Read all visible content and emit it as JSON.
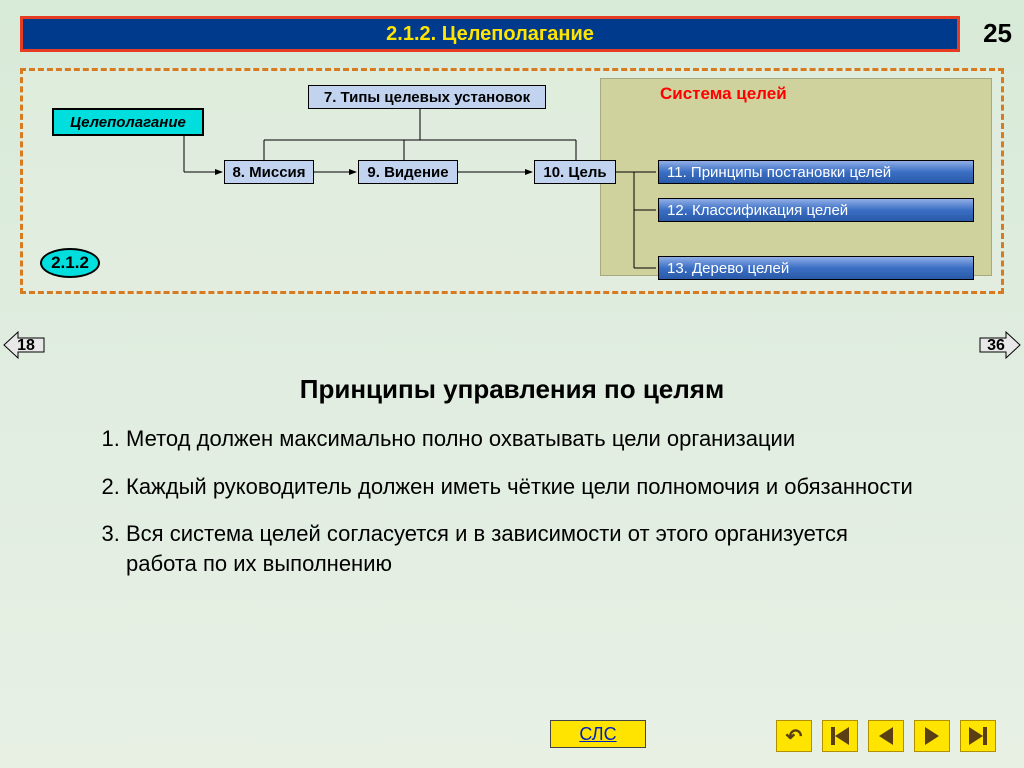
{
  "header": {
    "title": "2.1.2. Целеполагание",
    "slide_number": "25"
  },
  "diagram": {
    "main_label": "Целеполагание",
    "marker": "2.1.2",
    "system_label": "Система целей",
    "boxes": {
      "n7": "7. Типы целевых установок",
      "n8": "8. Миссия",
      "n9": "9. Видение",
      "n10": "10. Цель",
      "n11": "11. Принципы постановки целей",
      "n12": "12. Классификация целей",
      "n13": "13. Дерево целей"
    }
  },
  "nav": {
    "prev": "18",
    "next": "36",
    "sls": "СЛС"
  },
  "content": {
    "title": "Принципы управления по целям",
    "items": [
      "Метод должен максимально полно охватывать цели организации",
      "Каждый руководитель должен иметь чёткие цели полномочия и обязанности",
      "Вся система целей согласуется и в зависимости от этого организуется работа по их выполнению"
    ]
  }
}
